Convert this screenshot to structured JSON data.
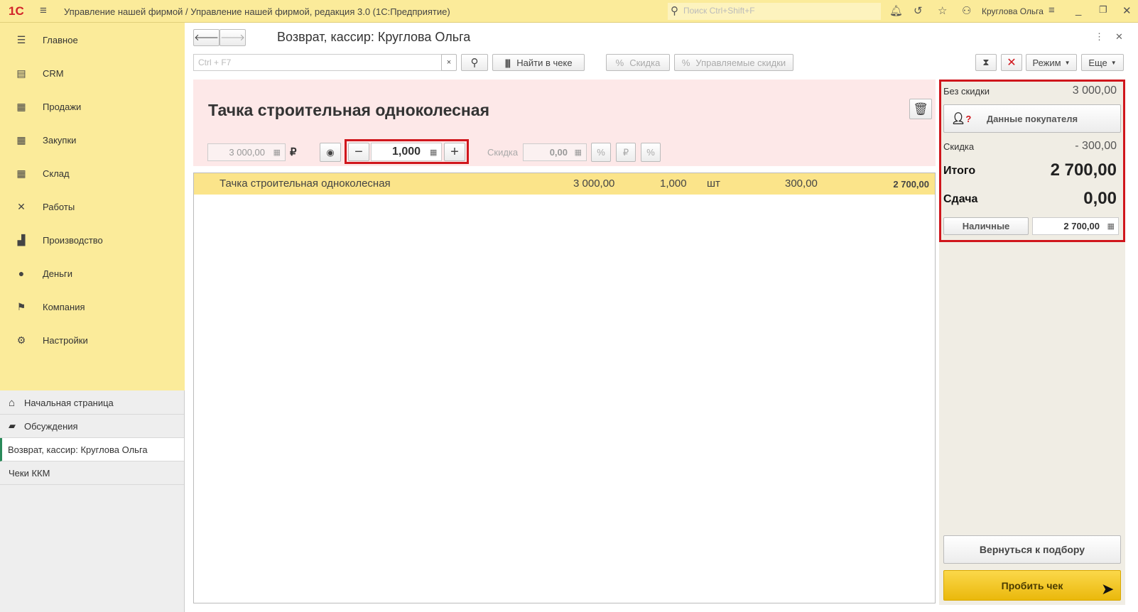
{
  "titlebar": {
    "logo": "1С",
    "app_title": "Управление нашей фирмой / Управление нашей фирмой, редакция 3.0  (1С:Предприятие)",
    "search_placeholder": "Поиск Ctrl+Shift+F",
    "user": "Круглова Ольга",
    "icons": [
      "bell-icon",
      "history-icon",
      "star-icon",
      "user-icon",
      "menu-icon",
      "minimize-icon",
      "restore-icon",
      "close-icon"
    ]
  },
  "sidebar": {
    "items": [
      {
        "label": "Главное",
        "icon": "☰"
      },
      {
        "label": "CRM",
        "icon": "▤"
      },
      {
        "label": "Продажи",
        "icon": "▦"
      },
      {
        "label": "Закупки",
        "icon": "▦"
      },
      {
        "label": "Склад",
        "icon": "▦"
      },
      {
        "label": "Работы",
        "icon": "✕"
      },
      {
        "label": "Производство",
        "icon": "▟"
      },
      {
        "label": "Деньги",
        "icon": "●"
      },
      {
        "label": "Компания",
        "icon": "⚑"
      },
      {
        "label": "Настройки",
        "icon": "⚙"
      }
    ],
    "open": [
      {
        "label": "Начальная страница",
        "icon": "⌂"
      },
      {
        "label": "Обсуждения",
        "icon": "▰"
      },
      {
        "label": "Возврат, кассир: Круглова Ольга",
        "active": true
      },
      {
        "label": "Чеки ККМ"
      }
    ]
  },
  "form": {
    "title": "Возврат, кассир: Круглова Ольга",
    "search_placeholder": "Ctrl + F7",
    "find_in_receipt": "Найти в чеке",
    "discount": "Скидка",
    "managed_discounts": "Управляемые скидки",
    "mode": "Режим",
    "more": "Еще"
  },
  "product": {
    "name": "Тачка строительная одноколесная",
    "price": "3 000,00",
    "currency": "₽",
    "quantity": "1,000",
    "discount_label": "Скидка",
    "discount": "0,00"
  },
  "rows": [
    {
      "name": "Тачка строительная одноколесная",
      "price": "3 000,00",
      "qty": "1,000",
      "unit": "шт",
      "discount": "300,00",
      "sum": "2 700,00"
    }
  ],
  "summary": {
    "no_discount_label": "Без скидки",
    "no_discount": "3 000,00",
    "customer_button": "Данные покупателя",
    "discount_label": "Скидка",
    "discount": "- 300,00",
    "total_label": "Итого",
    "total": "2 700,00",
    "change_label": "Сдача",
    "change": "0,00",
    "cash_button": "Наличные",
    "cash": "2 700,00",
    "back_button": "Вернуться к подбору",
    "print_button": "Пробить чек"
  },
  "colors": {
    "accent_yellow": "#fbeb9a",
    "highlight_red": "#d0161c",
    "primary_button": "#f5c518"
  }
}
